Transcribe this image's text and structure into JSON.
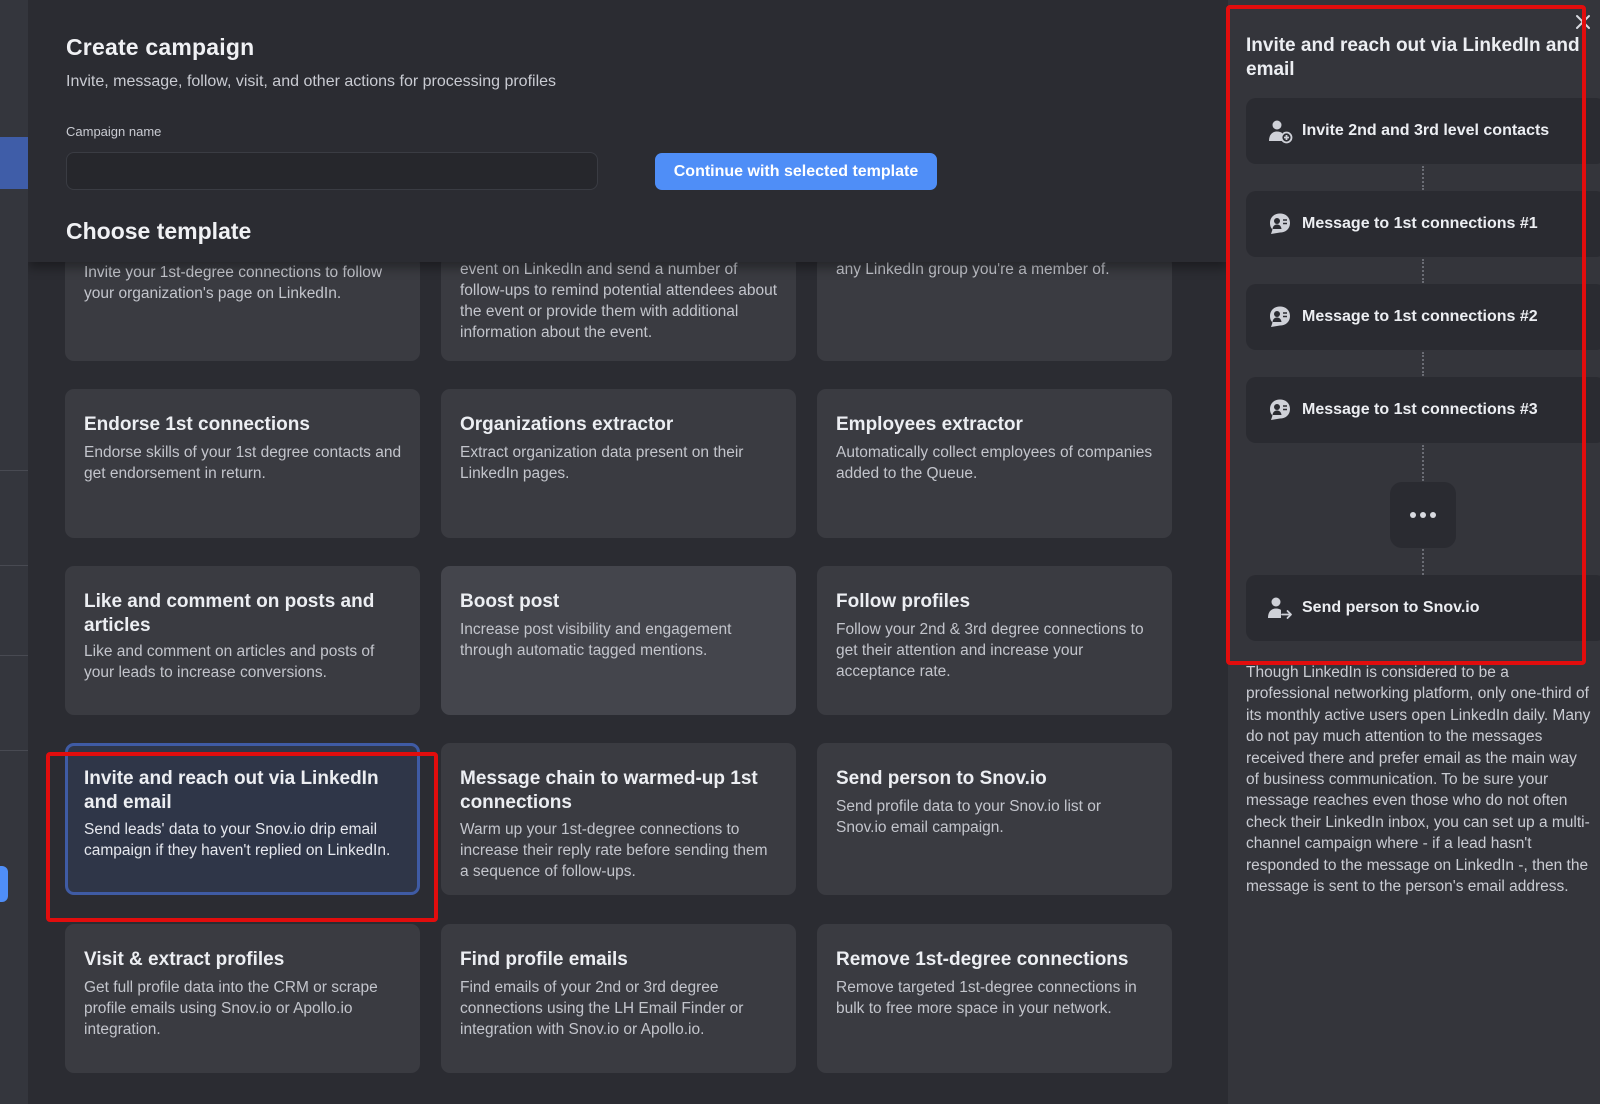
{
  "header": {
    "title": "Create campaign",
    "subtitle": "Invite, message, follow, visit, and other actions for processing profiles",
    "campaign_name_label": "Campaign name",
    "campaign_name_value": "",
    "continue_label": "Continue with selected template",
    "choose_template": "Choose template"
  },
  "templates": [
    {
      "title": "",
      "desc": "Invite your 1st-degree connections to follow your organization's page on LinkedIn."
    },
    {
      "title": "",
      "desc": "event on LinkedIn and send a number of follow-ups to remind potential attendees about the event or provide them with additional information about the event."
    },
    {
      "title": "",
      "desc": "any LinkedIn group you're a member of."
    },
    {
      "title": "Endorse 1st connections",
      "desc": "Endorse skills of your 1st degree contacts and get endorsement in return."
    },
    {
      "title": "Organizations extractor",
      "desc": "Extract organization data present on their LinkedIn pages."
    },
    {
      "title": "Employees extractor",
      "desc": "Automatically collect employees of companies added to the Queue."
    },
    {
      "title": "Like and comment on posts and articles",
      "desc": "Like and comment on articles and posts of your leads to increase conversions."
    },
    {
      "title": "Boost post",
      "desc": "Increase post visibility and engagement through automatic tagged mentions."
    },
    {
      "title": "Follow profiles",
      "desc": "Follow your 2nd & 3rd degree connections to get their attention and increase your acceptance rate."
    },
    {
      "title": "Invite and reach out via LinkedIn and email",
      "desc": "Send leads' data to your Snov.io drip email campaign if they haven't replied on LinkedIn."
    },
    {
      "title": "Message chain to warmed-up 1st connections",
      "desc": "Warm up your 1st-degree connections to increase their reply rate before sending them a sequence of follow-ups."
    },
    {
      "title": "Send person to Snov.io",
      "desc": "Send profile data to your Snov.io list or Snov.io email campaign."
    },
    {
      "title": "Visit & extract profiles",
      "desc": "Get full profile data into the CRM or scrape profile emails using Snov.io or Apollo.io integration."
    },
    {
      "title": "Find profile emails",
      "desc": "Find emails of your 2nd or 3rd degree connections using the LH Email Finder or integration with Snov.io or Apollo.io."
    },
    {
      "title": "Remove 1st-degree connections",
      "desc": "Remove targeted 1st-degree connections in bulk to free more space in your network."
    }
  ],
  "panel": {
    "title": "Invite and reach out via LinkedIn and email",
    "steps": [
      {
        "label": "Invite 2nd and 3rd level contacts",
        "icon": "add-person-icon"
      },
      {
        "label": "Message to 1st connections #1",
        "icon": "chat-person-icon"
      },
      {
        "label": "Message to 1st connections #2",
        "icon": "chat-person-icon"
      },
      {
        "label": "Message to 1st connections #3",
        "icon": "chat-person-icon"
      },
      {
        "label": "Send person to Snov.io",
        "icon": "send-person-icon"
      }
    ],
    "description": "Though LinkedIn is considered to be a professional networking platform, only one-third of its monthly active users open LinkedIn daily. Many do not pay much attention to the messages received there and prefer email as the main way of business communication. To be sure your message reaches even those who do not often check their LinkedIn inbox, you can set up a multi-channel campaign where - if a lead hasn't responded to the message on LinkedIn -, then the message is sent to the person's email address."
  },
  "colors": {
    "accent": "#4f8ef7",
    "annotation": "#e10d0d",
    "selected_border": "#3f5ba4"
  }
}
